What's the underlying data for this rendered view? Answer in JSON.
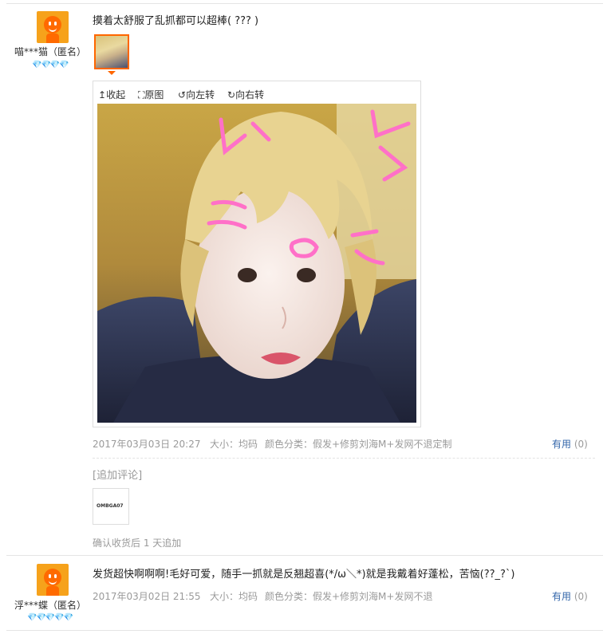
{
  "reviews": [
    {
      "username": "喵***猫（匿名）",
      "hearts": "💎💎💎💎",
      "content": "摸着太舒服了乱抓都可以超棒( ??? )",
      "viewer": {
        "collapse": "收起",
        "original": "原图",
        "rotate_left": "向左转",
        "rotate_right": "向右转"
      },
      "date": "2017年03月03日 20:27",
      "size": "大小：均码",
      "color": "颜色分类：假发+修剪刘海M+发网不退定制",
      "useful_label": "有用",
      "useful_count": "(0)",
      "append_label": "[追加评论]",
      "append_thumb_text": "OMBGA07",
      "append_note": "确认收货后 1 天追加"
    },
    {
      "username": "浮***蝶（匿名）",
      "hearts": "💎💎💎💎💎",
      "content": "发货超快啊啊啊!毛好可爱，随手一抓就是反翘超喜(*/ω＼*)就是我戴着好蓬松，苦恼(??_?`)",
      "date": "2017年03月02日 21:55",
      "size": "大小：均码",
      "color": "颜色分类：假发+修剪刘海M+发网不退",
      "useful_label": "有用",
      "useful_count": "(0)"
    }
  ]
}
